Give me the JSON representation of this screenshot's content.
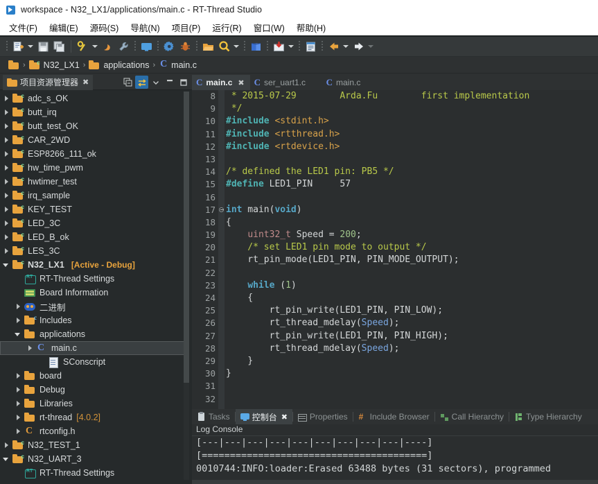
{
  "window": {
    "title": "workspace - N32_LX1/applications/main.c - RT-Thread Studio",
    "app_icon": "rt-thread-studio-icon"
  },
  "menubar": {
    "items": [
      {
        "label": "文件(F)",
        "name": "menu-file"
      },
      {
        "label": "编辑(E)",
        "name": "menu-edit"
      },
      {
        "label": "源码(S)",
        "name": "menu-source"
      },
      {
        "label": "导航(N)",
        "name": "menu-navigate"
      },
      {
        "label": "项目(P)",
        "name": "menu-project"
      },
      {
        "label": "运行(R)",
        "name": "menu-run"
      },
      {
        "label": "窗口(W)",
        "name": "menu-window"
      },
      {
        "label": "帮助(H)",
        "name": "menu-help"
      }
    ]
  },
  "toolbar": {
    "buttons": [
      {
        "name": "new-file-icon",
        "tip": "New"
      },
      {
        "name": "new-dropdown-arrow",
        "tip": "New dropdown"
      },
      {
        "name": "save-icon",
        "tip": "Save"
      },
      {
        "name": "save-all-icon",
        "tip": "Save All"
      },
      {
        "name": "build-icon",
        "tip": "Build"
      },
      {
        "name": "build-dropdown-arrow",
        "tip": "Build dropdown"
      },
      {
        "name": "clean-icon",
        "tip": "Clean"
      },
      {
        "name": "wrench-icon",
        "tip": "Build Settings"
      },
      {
        "name": "terminal-icon",
        "tip": "Terminal"
      },
      {
        "name": "settings-gear-icon",
        "tip": "Settings"
      },
      {
        "name": "debug-bug-icon",
        "tip": "Debug"
      },
      {
        "name": "open-folder-icon",
        "tip": "Open Resource"
      },
      {
        "name": "search-icon",
        "tip": "Search"
      },
      {
        "name": "search-dropdown-arrow",
        "tip": "Search dropdown"
      },
      {
        "name": "book-icon",
        "tip": "Documentation"
      },
      {
        "name": "download-icon",
        "tip": "Download"
      },
      {
        "name": "download-dropdown-arrow",
        "tip": "Download dropdown"
      },
      {
        "name": "package-icon",
        "tip": "Package Manager"
      },
      {
        "name": "back-arrow-icon",
        "tip": "Back"
      },
      {
        "name": "back-dropdown-arrow",
        "tip": "Back history"
      },
      {
        "name": "forward-arrow-icon",
        "tip": "Forward"
      },
      {
        "name": "forward-dropdown-arrow",
        "tip": "Forward history"
      }
    ]
  },
  "breadcrumb": {
    "items": [
      {
        "label": "",
        "icon": "workspace-folder-icon"
      },
      {
        "label": "N32_LX1",
        "icon": "project-icon"
      },
      {
        "label": "applications",
        "icon": "folder-icon"
      },
      {
        "label": "main.c",
        "icon": "c-file-icon"
      }
    ],
    "separator": "›"
  },
  "explorer": {
    "tab_label": "项目资源管理器",
    "tab_close": "✖",
    "tools": [
      {
        "name": "collapse-all-icon"
      },
      {
        "name": "link-with-editor-icon",
        "active": true
      },
      {
        "name": "view-menu-chevron-icon"
      },
      {
        "name": "minimize-icon"
      },
      {
        "name": "maximize-icon"
      }
    ],
    "tree": [
      {
        "label": "adc_s_OK",
        "indent": 0,
        "twisty": "closed",
        "icon": "project-icon"
      },
      {
        "label": "butt_irq",
        "indent": 0,
        "twisty": "closed",
        "icon": "project-icon"
      },
      {
        "label": "butt_test_OK",
        "indent": 0,
        "twisty": "closed",
        "icon": "project-icon"
      },
      {
        "label": "CAR_2WD",
        "indent": 0,
        "twisty": "closed",
        "icon": "project-icon"
      },
      {
        "label": "ESP8266_111_ok",
        "indent": 0,
        "twisty": "closed",
        "icon": "project-icon"
      },
      {
        "label": "hw_time_pwm",
        "indent": 0,
        "twisty": "closed",
        "icon": "project-icon"
      },
      {
        "label": "hwtimer_test",
        "indent": 0,
        "twisty": "closed",
        "icon": "project-icon"
      },
      {
        "label": "irq_sample",
        "indent": 0,
        "twisty": "closed",
        "icon": "project-icon"
      },
      {
        "label": "KEY_TEST",
        "indent": 0,
        "twisty": "closed",
        "icon": "project-icon"
      },
      {
        "label": "LED_3C",
        "indent": 0,
        "twisty": "closed",
        "icon": "project-icon"
      },
      {
        "label": "LED_B_ok",
        "indent": 0,
        "twisty": "closed",
        "icon": "project-icon"
      },
      {
        "label": "LES_3C",
        "indent": 0,
        "twisty": "closed",
        "icon": "project-icon"
      },
      {
        "label": "N32_LX1",
        "indent": 0,
        "twisty": "open",
        "icon": "project-icon",
        "bold": true,
        "badge": "[Active - Debug]"
      },
      {
        "label": "RT-Thread Settings",
        "indent": 1,
        "twisty": "none",
        "icon": "rt-settings-icon"
      },
      {
        "label": "Board Information",
        "indent": 1,
        "twisty": "none",
        "icon": "board-info-icon"
      },
      {
        "label": "二进制",
        "indent": 1,
        "twisty": "closed",
        "icon": "binaries-icon"
      },
      {
        "label": "Includes",
        "indent": 1,
        "twisty": "closed",
        "icon": "includes-icon"
      },
      {
        "label": "applications",
        "indent": 1,
        "twisty": "open",
        "icon": "folder-icon"
      },
      {
        "label": "main.c",
        "indent": 2,
        "twisty": "closed",
        "icon": "c-file-icon",
        "selected": true
      },
      {
        "label": "SConscript",
        "indent": 3,
        "twisty": "none",
        "icon": "text-file-icon"
      },
      {
        "label": "board",
        "indent": 1,
        "twisty": "closed",
        "icon": "folder-icon"
      },
      {
        "label": "Debug",
        "indent": 1,
        "twisty": "closed",
        "icon": "folder-icon"
      },
      {
        "label": "Libraries",
        "indent": 1,
        "twisty": "closed",
        "icon": "folder-icon"
      },
      {
        "label": "rt-thread",
        "indent": 1,
        "twisty": "closed",
        "icon": "folder-icon",
        "version": "[4.0.2]"
      },
      {
        "label": "rtconfig.h",
        "indent": 1,
        "twisty": "closed",
        "icon": "h-file-icon"
      },
      {
        "label": "N32_TEST_1",
        "indent": 0,
        "twisty": "closed",
        "icon": "project-icon"
      },
      {
        "label": "N32_UART_3",
        "indent": 0,
        "twisty": "open",
        "icon": "project-icon"
      },
      {
        "label": "RT-Thread Settings",
        "indent": 1,
        "twisty": "none",
        "icon": "rt-settings-icon"
      }
    ]
  },
  "editor": {
    "tabs": [
      {
        "label": "main.c",
        "active": true,
        "close": "✖",
        "icon": "c-file-icon"
      },
      {
        "label": "ser_uart1.c",
        "active": false,
        "close": "",
        "icon": "c-file-icon"
      },
      {
        "label": "main.c",
        "active": false,
        "close": "",
        "icon": "c-file-icon"
      }
    ],
    "first_line_number": 8,
    "lines": [
      {
        "n": 8,
        "fold": false,
        "tokens": [
          {
            "t": " * 2015-07-29        Arda.Fu        first implementation",
            "c": "k-cmt"
          }
        ]
      },
      {
        "n": 9,
        "fold": false,
        "tokens": [
          {
            "t": " */",
            "c": "k-cmt"
          }
        ]
      },
      {
        "n": 10,
        "fold": false,
        "tokens": [
          {
            "t": "#include",
            "c": "k-pp"
          },
          {
            "t": " ",
            "c": "k-txt"
          },
          {
            "t": "<stdint.h>",
            "c": "k-hdr"
          }
        ]
      },
      {
        "n": 11,
        "fold": false,
        "tokens": [
          {
            "t": "#include",
            "c": "k-pp"
          },
          {
            "t": " ",
            "c": "k-txt"
          },
          {
            "t": "<rtthread.h>",
            "c": "k-hdr"
          }
        ]
      },
      {
        "n": 12,
        "fold": false,
        "tokens": [
          {
            "t": "#include",
            "c": "k-pp"
          },
          {
            "t": " ",
            "c": "k-txt"
          },
          {
            "t": "<rtdevice.h>",
            "c": "k-hdr"
          }
        ]
      },
      {
        "n": 13,
        "fold": false,
        "tokens": []
      },
      {
        "n": 14,
        "fold": false,
        "tokens": [
          {
            "t": "/* defined the LED1 pin: PB5 */",
            "c": "k-cmt"
          }
        ]
      },
      {
        "n": 15,
        "fold": false,
        "tokens": [
          {
            "t": "#define",
            "c": "k-pp"
          },
          {
            "t": " LED1_PIN     57",
            "c": "k-txt"
          }
        ]
      },
      {
        "n": 16,
        "fold": false,
        "tokens": []
      },
      {
        "n": 17,
        "fold": true,
        "tokens": [
          {
            "t": "int",
            "c": "k-kw"
          },
          {
            "t": " main(",
            "c": "k-txt"
          },
          {
            "t": "void",
            "c": "k-kw"
          },
          {
            "t": ")",
            "c": "k-txt"
          }
        ]
      },
      {
        "n": 18,
        "fold": false,
        "tokens": [
          {
            "t": "{",
            "c": "k-txt"
          }
        ]
      },
      {
        "n": 19,
        "fold": false,
        "tokens": [
          {
            "t": "    ",
            "c": "k-txt"
          },
          {
            "t": "uint32_t",
            "c": "k-type"
          },
          {
            "t": " Speed = ",
            "c": "k-txt"
          },
          {
            "t": "200",
            "c": "k-num"
          },
          {
            "t": ";",
            "c": "k-txt"
          }
        ]
      },
      {
        "n": 20,
        "fold": false,
        "tokens": [
          {
            "t": "    /* set LED1 pin mode to output */",
            "c": "k-cmt"
          }
        ]
      },
      {
        "n": 21,
        "fold": false,
        "tokens": [
          {
            "t": "    rt_pin_mode(LED1_PIN, PIN_MODE_OUTPUT);",
            "c": "k-txt"
          }
        ]
      },
      {
        "n": 22,
        "fold": false,
        "tokens": []
      },
      {
        "n": 23,
        "fold": false,
        "tokens": [
          {
            "t": "    ",
            "c": "k-txt"
          },
          {
            "t": "while",
            "c": "k-kw"
          },
          {
            "t": " (",
            "c": "k-txt"
          },
          {
            "t": "1",
            "c": "k-num"
          },
          {
            "t": ")",
            "c": "k-txt"
          }
        ]
      },
      {
        "n": 24,
        "fold": false,
        "tokens": [
          {
            "t": "    {",
            "c": "k-txt"
          }
        ]
      },
      {
        "n": 25,
        "fold": false,
        "tokens": [
          {
            "t": "        rt_pin_write(LED1_PIN, PIN_LOW);",
            "c": "k-txt"
          }
        ]
      },
      {
        "n": 26,
        "fold": false,
        "tokens": [
          {
            "t": "        rt_thread_mdelay(",
            "c": "k-txt"
          },
          {
            "t": "Speed",
            "c": "k-var"
          },
          {
            "t": ");",
            "c": "k-txt"
          }
        ]
      },
      {
        "n": 27,
        "fold": false,
        "tokens": [
          {
            "t": "        rt_pin_write(LED1_PIN, PIN_HIGH);",
            "c": "k-txt"
          }
        ]
      },
      {
        "n": 28,
        "fold": false,
        "tokens": [
          {
            "t": "        rt_thread_mdelay(",
            "c": "k-txt"
          },
          {
            "t": "Speed",
            "c": "k-var"
          },
          {
            "t": ");",
            "c": "k-txt"
          }
        ]
      },
      {
        "n": 29,
        "fold": false,
        "tokens": [
          {
            "t": "    }",
            "c": "k-txt"
          }
        ]
      },
      {
        "n": 30,
        "fold": false,
        "tokens": [
          {
            "t": "}",
            "c": "k-txt"
          }
        ]
      },
      {
        "n": 31,
        "fold": false,
        "tokens": []
      },
      {
        "n": 32,
        "fold": false,
        "tokens": []
      }
    ]
  },
  "console": {
    "tabs": [
      {
        "label": "Tasks",
        "active": false,
        "icon": "tasks-icon",
        "close": ""
      },
      {
        "label": "控制台",
        "active": true,
        "icon": "console-icon",
        "close": "✖"
      },
      {
        "label": "Properties",
        "active": false,
        "icon": "properties-icon",
        "close": ""
      },
      {
        "label": "Include Browser",
        "active": false,
        "icon": "include-browser-icon",
        "close": ""
      },
      {
        "label": "Call Hierarchy",
        "active": false,
        "icon": "call-hierarchy-icon",
        "close": ""
      },
      {
        "label": "Type Hierarchy",
        "active": false,
        "icon": "type-hierarchy-icon",
        "close": ""
      }
    ],
    "log_title": "Log Console",
    "log_lines": [
      "[---|---|---|---|---|---|---|---|---|----]",
      "[========================================]",
      "0010744:INFO:loader:Erased 63488 bytes (31 sectors), programmed"
    ]
  },
  "colors": {
    "accent_blue": "#2a6ea8",
    "folder_orange": "#e8a33d",
    "badge_orange": "#e8a33d",
    "comment_green": "#b9c94a",
    "preproc_teal": "#4fb3b3",
    "header_orange": "#d8a24a",
    "keyword_blue": "#56a6c6",
    "bg_dark": "#2b2e2f",
    "bg_panel": "#262a2b"
  }
}
